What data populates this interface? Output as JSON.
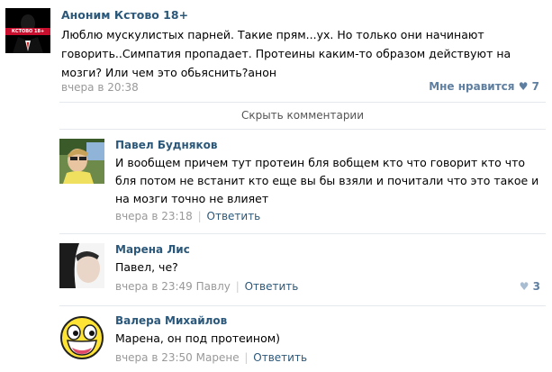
{
  "post": {
    "author": "Аноним Кстово 18+",
    "avatar_label": "КСТОВО 18+",
    "text": "Люблю мускулистых парней. Такие прям...ух. Но только они начинают говорить..Симпатия пропадает. Протеины каким-то образом действуют на мозги? Или чем это обьяснить?анон",
    "date": "вчера в 20:38",
    "like_label": "Мне нравится",
    "like_count": "7"
  },
  "hide_comments_label": "Скрыть комментарии",
  "comments": [
    {
      "author": "Павел Будняков",
      "text": "И вообщем причем тут протеин бля вобщем кто что говорит кто что бля потом не встанит кто еще вы бы взяли и почитали что это такое и на мозги точно не влияет",
      "date": "вчера в 23:18",
      "reply_to": "",
      "reply_label": "Ответить",
      "likes": ""
    },
    {
      "author": "Марена Лис",
      "text": "Павел, че?",
      "date": "вчера в 23:49",
      "reply_to": "Павлу",
      "reply_label": "Ответить",
      "likes": "3"
    },
    {
      "author": "Валера Михайлов",
      "text": "Марена, он под протеином)",
      "date": "вчера в 23:50",
      "reply_to": "Марене",
      "reply_label": "Ответить",
      "likes": ""
    }
  ],
  "colors": {
    "link": "#2b587a",
    "muted": "#999999",
    "like": "#5f7fa1",
    "separator": "#e5e9ee"
  }
}
